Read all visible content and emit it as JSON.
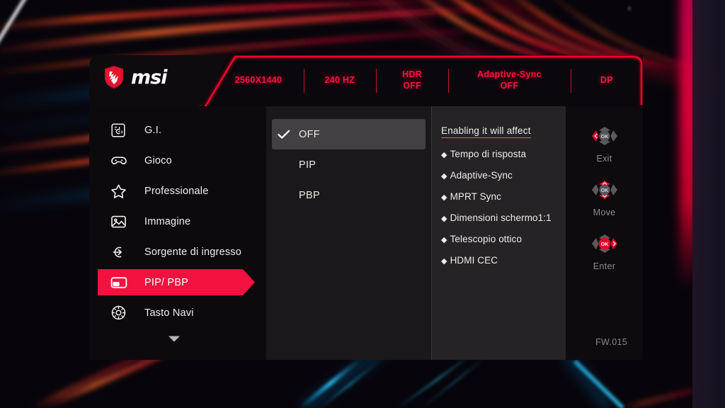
{
  "device": {
    "brand": "msi",
    "logo_icon": "msi-dragon-shield-icon",
    "firmware": "FW.015"
  },
  "header": {
    "items": [
      {
        "name": "resolution",
        "line1": "2560X1440",
        "line2": ""
      },
      {
        "name": "refresh-rate",
        "line1": "240 HZ",
        "line2": ""
      },
      {
        "name": "hdr-status",
        "line1": "HDR",
        "line2": "OFF"
      },
      {
        "name": "adaptive-sync-status",
        "line1": "Adaptive-Sync",
        "line2": "OFF"
      },
      {
        "name": "input-source",
        "line1": "DP",
        "line2": ""
      }
    ]
  },
  "sidebar": {
    "items": [
      {
        "label": "G.I.",
        "icon": "gaming-intelligence-icon",
        "active": false
      },
      {
        "label": "Gioco",
        "icon": "gamepad-icon",
        "active": false
      },
      {
        "label": "Professionale",
        "icon": "star-icon",
        "active": false
      },
      {
        "label": "Immagine",
        "icon": "image-icon",
        "active": false
      },
      {
        "label": "Sorgente di ingresso",
        "icon": "input-arrow-icon",
        "active": false
      },
      {
        "label": "PIP/ PBP",
        "icon": "pip-pbp-icon",
        "active": true
      },
      {
        "label": "Tasto Navi",
        "icon": "navi-key-icon",
        "active": false
      }
    ],
    "more_icon": "chevron-down-icon"
  },
  "options": {
    "items": [
      {
        "label": "OFF",
        "selected": true
      },
      {
        "label": "PIP",
        "selected": false
      },
      {
        "label": "PBP",
        "selected": false
      }
    ],
    "check_icon": "checkmark-icon"
  },
  "info": {
    "title": "Enabling it will affect",
    "bullet": "◆",
    "items": [
      "Tempo di risposta",
      "Adaptive-Sync",
      "MPRT Sync",
      "Dimensioni schermo1:1",
      "Telescopio ottico",
      "HDMI CEC"
    ]
  },
  "nav_controls": [
    {
      "label": "Exit",
      "icon": "joystick-left-icon",
      "highlight": "left"
    },
    {
      "label": "Move",
      "icon": "joystick-up-down-icon",
      "highlight": "updown"
    },
    {
      "label": "Enter",
      "icon": "joystick-ok-right-icon",
      "highlight": "okright"
    }
  ],
  "colors": {
    "brand_red": "#f3123f",
    "header_red": "#f5123f",
    "panel_bg": "#0d0b0e",
    "mid_bg": "#1a181a",
    "info_bg": "#252325",
    "selected_row": "#424042",
    "text": "#f2eeee",
    "muted": "#8b8789",
    "underline": "#e8604f"
  }
}
